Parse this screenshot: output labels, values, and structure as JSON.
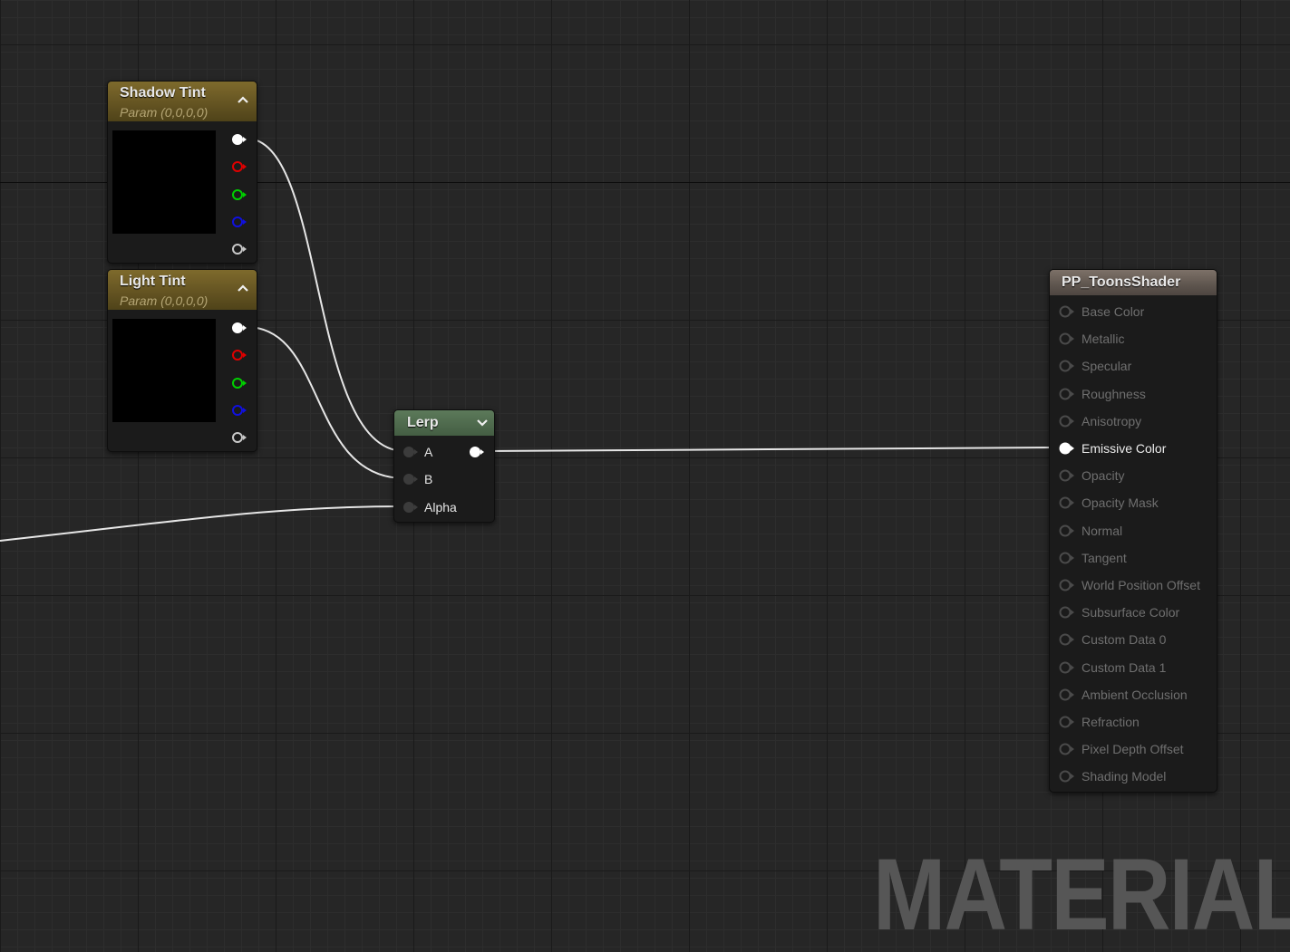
{
  "graph": {
    "watermark": "MATERIAL"
  },
  "nodes": {
    "shadow_tint": {
      "title": "Shadow Tint",
      "subtitle": "Param (0,0,0,0)",
      "swatch_color": "#000000",
      "outputs": [
        "rgba-pin",
        "red-pin",
        "green-pin",
        "blue-pin",
        "alpha-pin"
      ]
    },
    "light_tint": {
      "title": "Light Tint",
      "subtitle": "Param (0,0,0,0)",
      "swatch_color": "#000000",
      "outputs": [
        "rgba-pin",
        "red-pin",
        "green-pin",
        "blue-pin",
        "alpha-pin"
      ]
    },
    "lerp": {
      "title": "Lerp",
      "inputs": [
        "A",
        "B",
        "Alpha"
      ]
    },
    "result": {
      "title": "PP_ToonsShader",
      "inputs": [
        "Base Color",
        "Metallic",
        "Specular",
        "Roughness",
        "Anisotropy",
        "Emissive Color",
        "Opacity",
        "Opacity Mask",
        "Normal",
        "Tangent",
        "World Position Offset",
        "Subsurface Color",
        "Custom Data 0",
        "Custom Data 1",
        "Ambient Occlusion",
        "Refraction",
        "Pixel Depth Offset",
        "Shading Model"
      ],
      "connected_input": "Emissive Color"
    }
  },
  "colors": {
    "param_header": "#7e6a2c",
    "lerp_header": "#5c7a5a",
    "material_header": "#7d7168",
    "wire": "#e6e6e6",
    "pin_red": "#e00000",
    "pin_green": "#00d000",
    "pin_blue": "#1010e0"
  }
}
